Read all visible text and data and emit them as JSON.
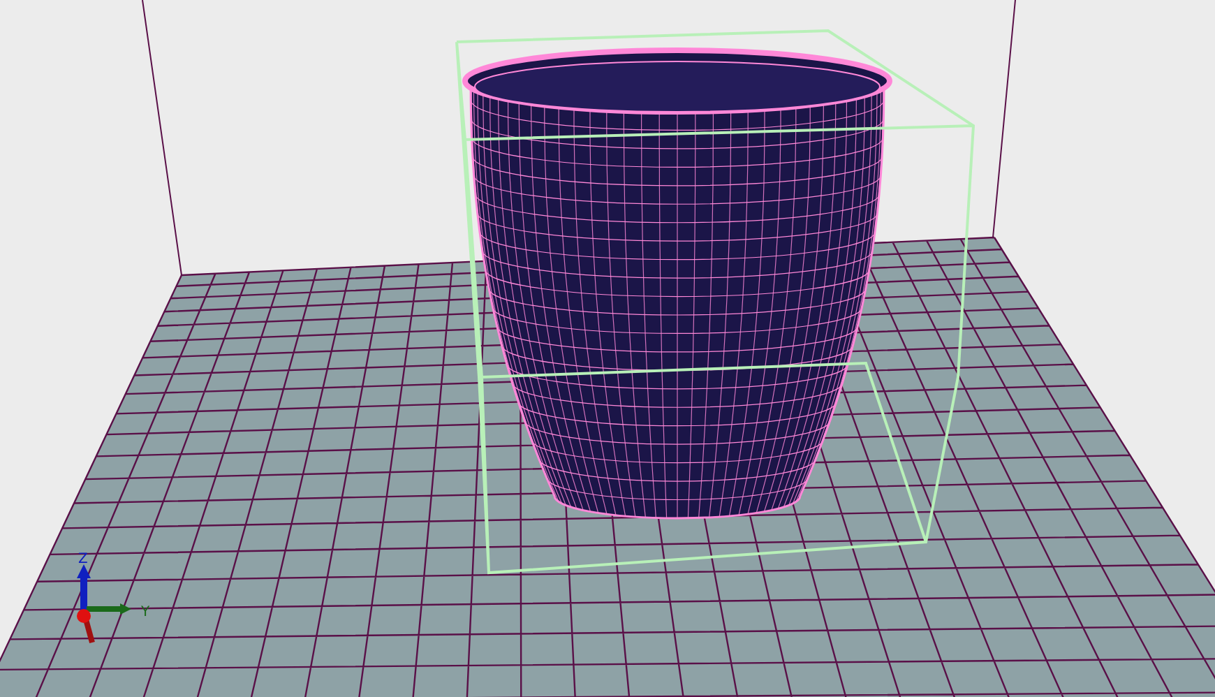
{
  "viewport": {
    "axis_gizmo": {
      "labels": [
        {
          "text": "Z",
          "color": "#1020c0"
        },
        {
          "text": "Y",
          "color": "#1a6a1a"
        }
      ]
    }
  }
}
